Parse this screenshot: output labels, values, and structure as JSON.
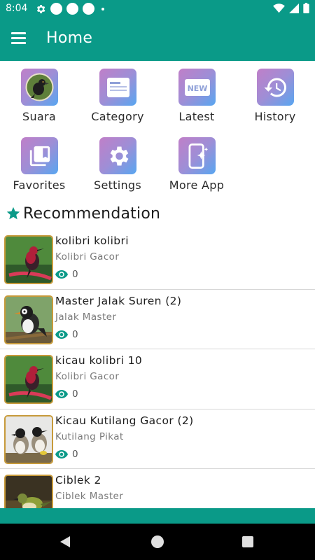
{
  "status_bar": {
    "time": "8:04"
  },
  "app_bar": {
    "title": "Home",
    "menu_icon": "hamburger-menu-icon"
  },
  "menu_grid": [
    {
      "label": "Suara",
      "icon": "bird-icon"
    },
    {
      "label": "Category",
      "icon": "category-card-icon"
    },
    {
      "label": "Latest",
      "icon": "new-badge-icon"
    },
    {
      "label": "History",
      "icon": "history-clock-icon"
    },
    {
      "label": "Favorites",
      "icon": "bookmark-stack-icon"
    },
    {
      "label": "Settings",
      "icon": "gear-icon"
    },
    {
      "label": "More App",
      "icon": "phone-sparkle-icon"
    }
  ],
  "section": {
    "title": "Recommendation",
    "icon": "star-icon"
  },
  "recommendations": [
    {
      "title": "kolibri kolibri",
      "category": "Kolibri Gacor",
      "views": "0"
    },
    {
      "title": "Master Jalak Suren (2)",
      "category": "Jalak Master",
      "views": "0"
    },
    {
      "title": "kicau kolibri 10",
      "category": "Kolibri Gacor",
      "views": "0"
    },
    {
      "title": "Kicau Kutilang Gacor (2)",
      "category": "Kutilang Pikat",
      "views": "0"
    },
    {
      "title": "Ciblek 2",
      "category": "Ciblek Master",
      "views": "0"
    }
  ],
  "colors": {
    "primary": "#0a9a88",
    "accent_star": "#0a9a88",
    "tile_gradient_start": "#c07fc8",
    "tile_gradient_end": "#58a6f0",
    "thumb_border": "#c79a3a"
  }
}
